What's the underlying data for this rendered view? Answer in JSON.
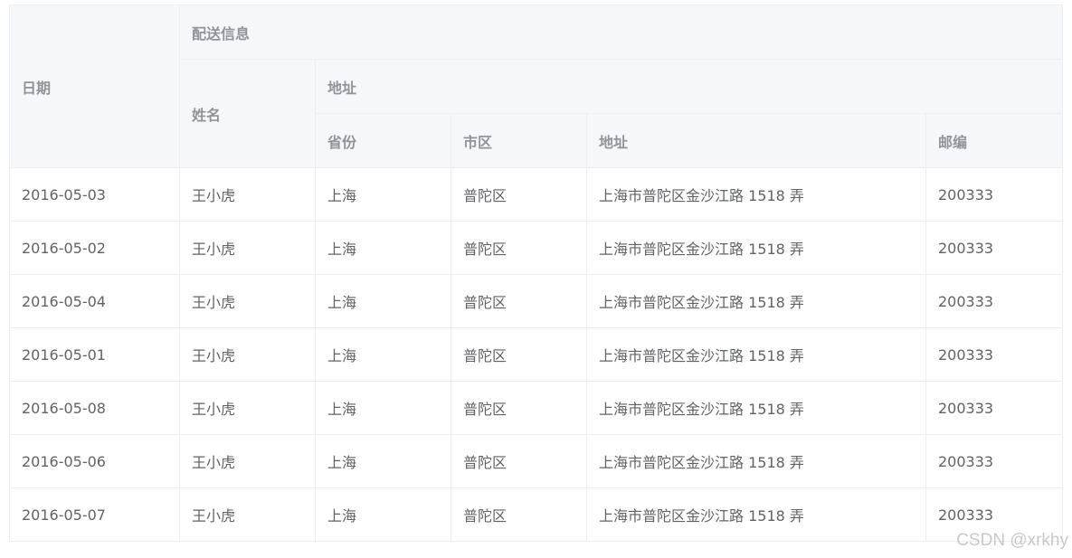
{
  "header": {
    "date": "日期",
    "shipping_group": "配送信息",
    "name": "姓名",
    "address_group": "地址",
    "province": "省份",
    "city": "市区",
    "address": "地址",
    "zip": "邮编"
  },
  "rows": [
    {
      "date": "2016-05-03",
      "name": "王小虎",
      "province": "上海",
      "city": "普陀区",
      "address": "上海市普陀区金沙江路 1518 弄",
      "zip": "200333"
    },
    {
      "date": "2016-05-02",
      "name": "王小虎",
      "province": "上海",
      "city": "普陀区",
      "address": "上海市普陀区金沙江路 1518 弄",
      "zip": "200333"
    },
    {
      "date": "2016-05-04",
      "name": "王小虎",
      "province": "上海",
      "city": "普陀区",
      "address": "上海市普陀区金沙江路 1518 弄",
      "zip": "200333"
    },
    {
      "date": "2016-05-01",
      "name": "王小虎",
      "province": "上海",
      "city": "普陀区",
      "address": "上海市普陀区金沙江路 1518 弄",
      "zip": "200333"
    },
    {
      "date": "2016-05-08",
      "name": "王小虎",
      "province": "上海",
      "city": "普陀区",
      "address": "上海市普陀区金沙江路 1518 弄",
      "zip": "200333"
    },
    {
      "date": "2016-05-06",
      "name": "王小虎",
      "province": "上海",
      "city": "普陀区",
      "address": "上海市普陀区金沙江路 1518 弄",
      "zip": "200333"
    },
    {
      "date": "2016-05-07",
      "name": "王小虎",
      "province": "上海",
      "city": "普陀区",
      "address": "上海市普陀区金沙江路 1518 弄",
      "zip": "200333"
    }
  ],
  "watermark": "CSDN @xrkhy",
  "colors": {
    "header_bg": "#f5f7fa",
    "header_text": "#909399",
    "cell_text": "#606266",
    "border": "#ebeef5"
  }
}
